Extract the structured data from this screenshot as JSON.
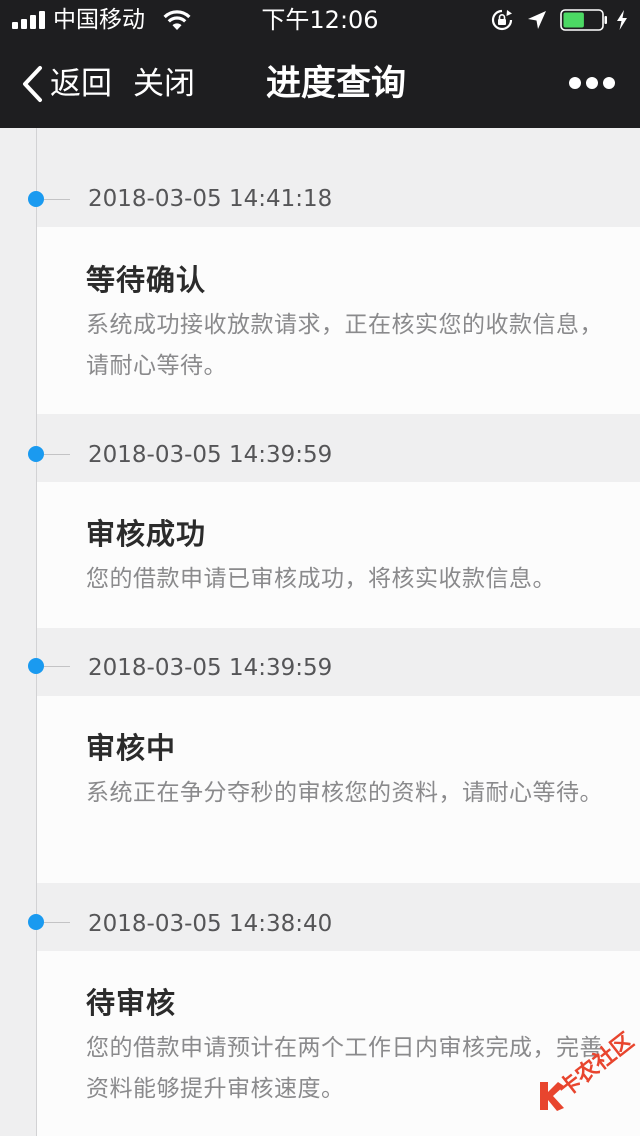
{
  "status_bar": {
    "carrier": "中国移动",
    "time": "下午12:06",
    "signal_bars": 4,
    "battery_level_percent": 55,
    "icons": [
      "signal-icon",
      "wifi-icon",
      "rotation-lock-icon",
      "location-arrow-icon",
      "battery-icon",
      "charging-bolt-icon"
    ]
  },
  "nav": {
    "back_label": "返回",
    "close_label": "关闭",
    "title": "进度查询",
    "more_icon": "more-dots-icon"
  },
  "colors": {
    "header_bg": "#1e1e20",
    "timeline_dot": "#1a9af0",
    "page_bg": "#efeff0",
    "card_bg": "#fcfcfc",
    "watermark": "#e8452e"
  },
  "timeline": [
    {
      "time": "2018-03-05 14:41:18",
      "title": "等待确认",
      "description": "系统成功接收放款请求，正在核实您的收款信息，请耐心等待。"
    },
    {
      "time": "2018-03-05 14:39:59",
      "title": "审核成功",
      "description": "您的借款申请已审核成功，将核实收款信息。"
    },
    {
      "time": "2018-03-05 14:39:59",
      "title": "审核中",
      "description": "系统正在争分夺秒的审核您的资料，请耐心等待。"
    },
    {
      "time": "2018-03-05 14:38:40",
      "title": "待审核",
      "description": "您的借款申请预计在两个工作日内审核完成，完善资料能够提升审核速度。"
    }
  ],
  "watermark": {
    "text": "卡农社区"
  }
}
